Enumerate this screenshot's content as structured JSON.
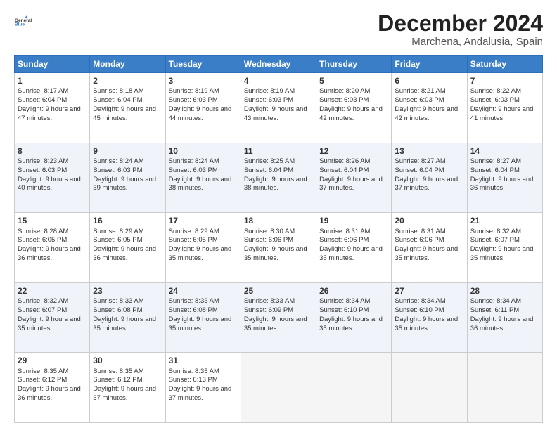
{
  "header": {
    "logo_line1": "General",
    "logo_line2": "Blue",
    "title": "December 2024",
    "subtitle": "Marchena, Andalusia, Spain"
  },
  "days_of_week": [
    "Sunday",
    "Monday",
    "Tuesday",
    "Wednesday",
    "Thursday",
    "Friday",
    "Saturday"
  ],
  "weeks": [
    [
      {
        "day": 1,
        "sunrise": "8:17 AM",
        "sunset": "6:04 PM",
        "daylight": "9 hours and 47 minutes."
      },
      {
        "day": 2,
        "sunrise": "8:18 AM",
        "sunset": "6:04 PM",
        "daylight": "9 hours and 45 minutes."
      },
      {
        "day": 3,
        "sunrise": "8:19 AM",
        "sunset": "6:03 PM",
        "daylight": "9 hours and 44 minutes."
      },
      {
        "day": 4,
        "sunrise": "8:19 AM",
        "sunset": "6:03 PM",
        "daylight": "9 hours and 43 minutes."
      },
      {
        "day": 5,
        "sunrise": "8:20 AM",
        "sunset": "6:03 PM",
        "daylight": "9 hours and 42 minutes."
      },
      {
        "day": 6,
        "sunrise": "8:21 AM",
        "sunset": "6:03 PM",
        "daylight": "9 hours and 42 minutes."
      },
      {
        "day": 7,
        "sunrise": "8:22 AM",
        "sunset": "6:03 PM",
        "daylight": "9 hours and 41 minutes."
      }
    ],
    [
      {
        "day": 8,
        "sunrise": "8:23 AM",
        "sunset": "6:03 PM",
        "daylight": "9 hours and 40 minutes."
      },
      {
        "day": 9,
        "sunrise": "8:24 AM",
        "sunset": "6:03 PM",
        "daylight": "9 hours and 39 minutes."
      },
      {
        "day": 10,
        "sunrise": "8:24 AM",
        "sunset": "6:03 PM",
        "daylight": "9 hours and 38 minutes."
      },
      {
        "day": 11,
        "sunrise": "8:25 AM",
        "sunset": "6:04 PM",
        "daylight": "9 hours and 38 minutes."
      },
      {
        "day": 12,
        "sunrise": "8:26 AM",
        "sunset": "6:04 PM",
        "daylight": "9 hours and 37 minutes."
      },
      {
        "day": 13,
        "sunrise": "8:27 AM",
        "sunset": "6:04 PM",
        "daylight": "9 hours and 37 minutes."
      },
      {
        "day": 14,
        "sunrise": "8:27 AM",
        "sunset": "6:04 PM",
        "daylight": "9 hours and 36 minutes."
      }
    ],
    [
      {
        "day": 15,
        "sunrise": "8:28 AM",
        "sunset": "6:05 PM",
        "daylight": "9 hours and 36 minutes."
      },
      {
        "day": 16,
        "sunrise": "8:29 AM",
        "sunset": "6:05 PM",
        "daylight": "9 hours and 36 minutes."
      },
      {
        "day": 17,
        "sunrise": "8:29 AM",
        "sunset": "6:05 PM",
        "daylight": "9 hours and 35 minutes."
      },
      {
        "day": 18,
        "sunrise": "8:30 AM",
        "sunset": "6:06 PM",
        "daylight": "9 hours and 35 minutes."
      },
      {
        "day": 19,
        "sunrise": "8:31 AM",
        "sunset": "6:06 PM",
        "daylight": "9 hours and 35 minutes."
      },
      {
        "day": 20,
        "sunrise": "8:31 AM",
        "sunset": "6:06 PM",
        "daylight": "9 hours and 35 minutes."
      },
      {
        "day": 21,
        "sunrise": "8:32 AM",
        "sunset": "6:07 PM",
        "daylight": "9 hours and 35 minutes."
      }
    ],
    [
      {
        "day": 22,
        "sunrise": "8:32 AM",
        "sunset": "6:07 PM",
        "daylight": "9 hours and 35 minutes."
      },
      {
        "day": 23,
        "sunrise": "8:33 AM",
        "sunset": "6:08 PM",
        "daylight": "9 hours and 35 minutes."
      },
      {
        "day": 24,
        "sunrise": "8:33 AM",
        "sunset": "6:08 PM",
        "daylight": "9 hours and 35 minutes."
      },
      {
        "day": 25,
        "sunrise": "8:33 AM",
        "sunset": "6:09 PM",
        "daylight": "9 hours and 35 minutes."
      },
      {
        "day": 26,
        "sunrise": "8:34 AM",
        "sunset": "6:10 PM",
        "daylight": "9 hours and 35 minutes."
      },
      {
        "day": 27,
        "sunrise": "8:34 AM",
        "sunset": "6:10 PM",
        "daylight": "9 hours and 35 minutes."
      },
      {
        "day": 28,
        "sunrise": "8:34 AM",
        "sunset": "6:11 PM",
        "daylight": "9 hours and 36 minutes."
      }
    ],
    [
      {
        "day": 29,
        "sunrise": "8:35 AM",
        "sunset": "6:12 PM",
        "daylight": "9 hours and 36 minutes."
      },
      {
        "day": 30,
        "sunrise": "8:35 AM",
        "sunset": "6:12 PM",
        "daylight": "9 hours and 37 minutes."
      },
      {
        "day": 31,
        "sunrise": "8:35 AM",
        "sunset": "6:13 PM",
        "daylight": "9 hours and 37 minutes."
      },
      null,
      null,
      null,
      null
    ]
  ],
  "labels": {
    "sunrise": "Sunrise:",
    "sunset": "Sunset:",
    "daylight": "Daylight:"
  }
}
